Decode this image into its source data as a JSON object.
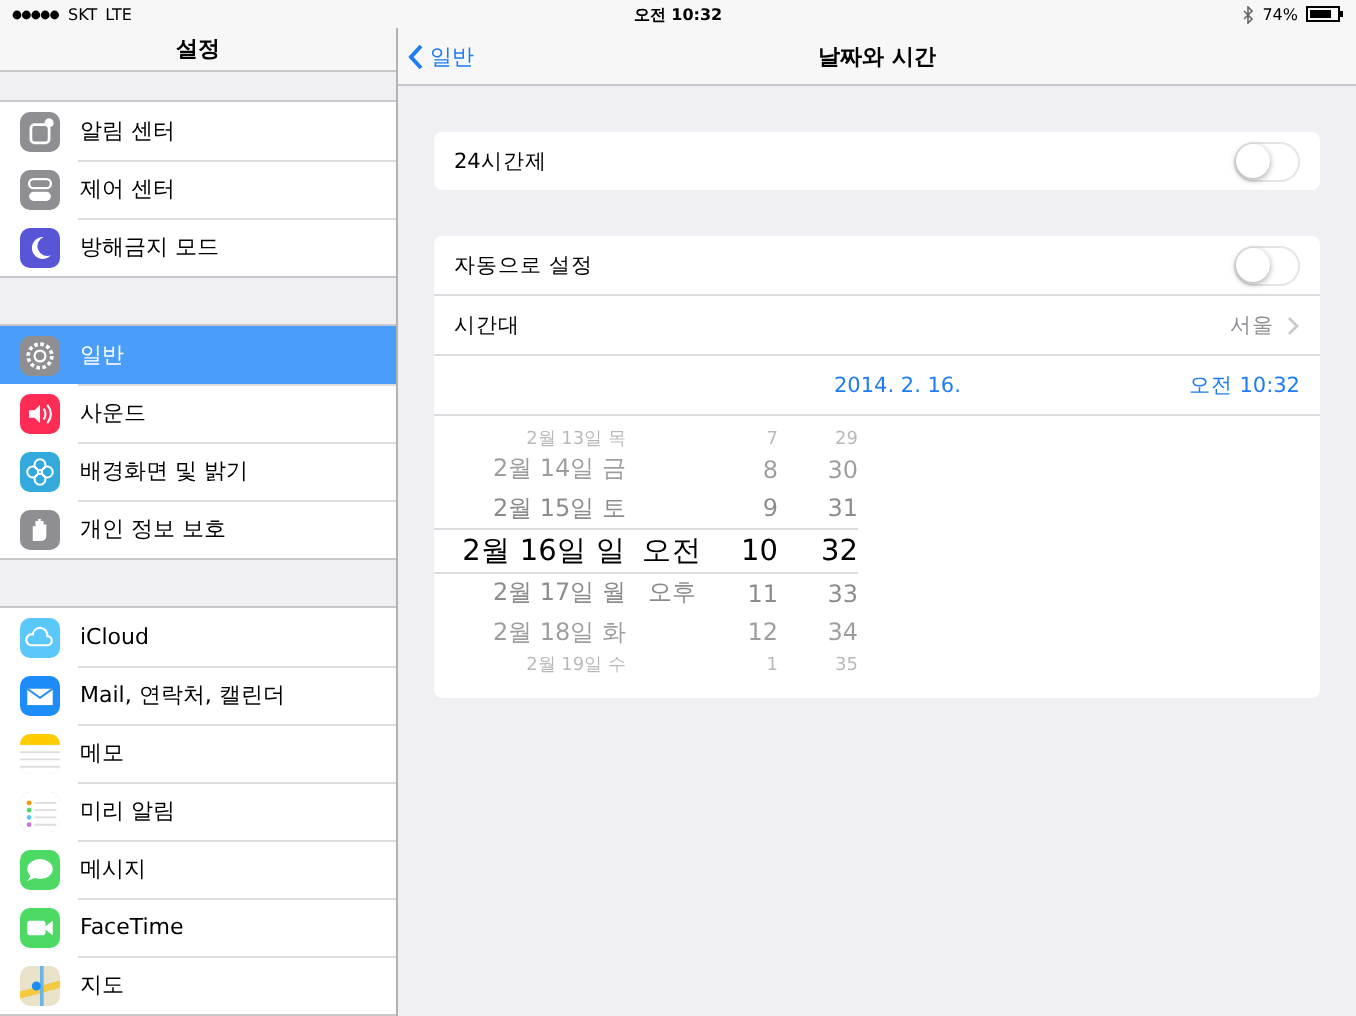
{
  "status_bar": {
    "carrier": "SKT",
    "network": "LTE",
    "time": "오전 10:32",
    "battery": "74%"
  },
  "sidebar": {
    "title": "설정",
    "groups": [
      {
        "items": [
          {
            "label": "알림 센터",
            "selected": false
          },
          {
            "label": "제어 센터",
            "selected": false
          },
          {
            "label": "방해금지 모드",
            "selected": false
          }
        ]
      },
      {
        "items": [
          {
            "label": "일반",
            "selected": true
          },
          {
            "label": "사운드",
            "selected": false
          },
          {
            "label": "배경화면 및 밝기",
            "selected": false
          },
          {
            "label": "개인 정보 보호",
            "selected": false
          }
        ]
      },
      {
        "items": [
          {
            "label": "iCloud",
            "selected": false
          },
          {
            "label": "Mail, 연락처, 캘린더",
            "selected": false
          },
          {
            "label": "메모",
            "selected": false
          },
          {
            "label": "미리 알림",
            "selected": false
          },
          {
            "label": "메시지",
            "selected": false
          },
          {
            "label": "FaceTime",
            "selected": false
          },
          {
            "label": "지도",
            "selected": false
          }
        ]
      }
    ]
  },
  "detail": {
    "back": "일반",
    "title": "날짜와 시간",
    "groups": [
      {
        "rows": [
          {
            "kind": "switch",
            "label": "24시간제",
            "on": false
          }
        ]
      },
      {
        "rows": [
          {
            "kind": "switch",
            "label": "자동으로 설정",
            "on": false
          },
          {
            "kind": "link",
            "label": "시간대",
            "value": "서울"
          },
          {
            "kind": "datetime",
            "date": "2014. 2. 16.",
            "time": "오전 10:32"
          },
          {
            "kind": "picker",
            "rows": [
              {
                "date": "2월 13일 목",
                "hour": "7",
                "minute": "29",
                "selected": false
              },
              {
                "date": "2월 14일 금",
                "hour": "8",
                "minute": "30",
                "selected": false
              },
              {
                "date": "2월 15일 토",
                "hour": "9",
                "minute": "31",
                "selected": false
              },
              {
                "date": "2월 16일 일",
                "ampm": "오전",
                "hour": "10",
                "minute": "32",
                "selected": true
              },
              {
                "date": "2월 17일 월",
                "ampm": "오후",
                "hour": "11",
                "minute": "33",
                "selected": false
              },
              {
                "date": "2월 18일 화",
                "hour": "12",
                "minute": "34",
                "selected": false
              },
              {
                "date": "2월 19일 수",
                "hour": "1",
                "minute": "35",
                "selected": false
              }
            ]
          }
        ]
      }
    ]
  }
}
